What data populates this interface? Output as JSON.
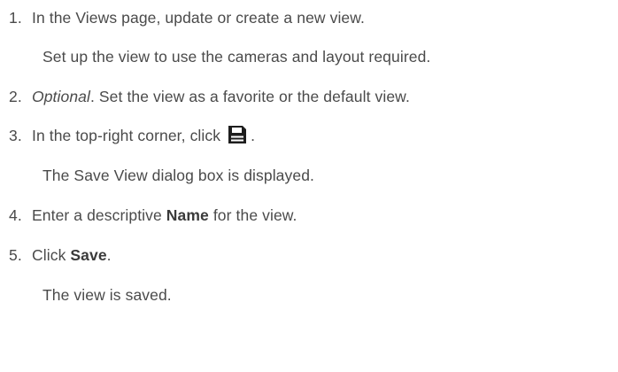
{
  "steps": [
    {
      "number": "1.",
      "text": "In the Views page, update or create a new view.",
      "detail": "Set up the view to use the cameras and layout required."
    },
    {
      "number": "2.",
      "italic": "Optional",
      "text": ". Set the view as a favorite or the default view."
    },
    {
      "number": "3.",
      "text": "In the top-right corner, click",
      "icon": "save-icon",
      "after": ".",
      "detail": "The Save View dialog box is displayed."
    },
    {
      "number": "4.",
      "before": "Enter a descriptive ",
      "bold": "Name",
      "after": " for the view."
    },
    {
      "number": "5.",
      "before": "Click ",
      "bold": "Save",
      "after": ".",
      "detail": "The view is saved."
    }
  ],
  "colors": {
    "text": "#4a4a4a",
    "icon": "#1e1e1e"
  }
}
